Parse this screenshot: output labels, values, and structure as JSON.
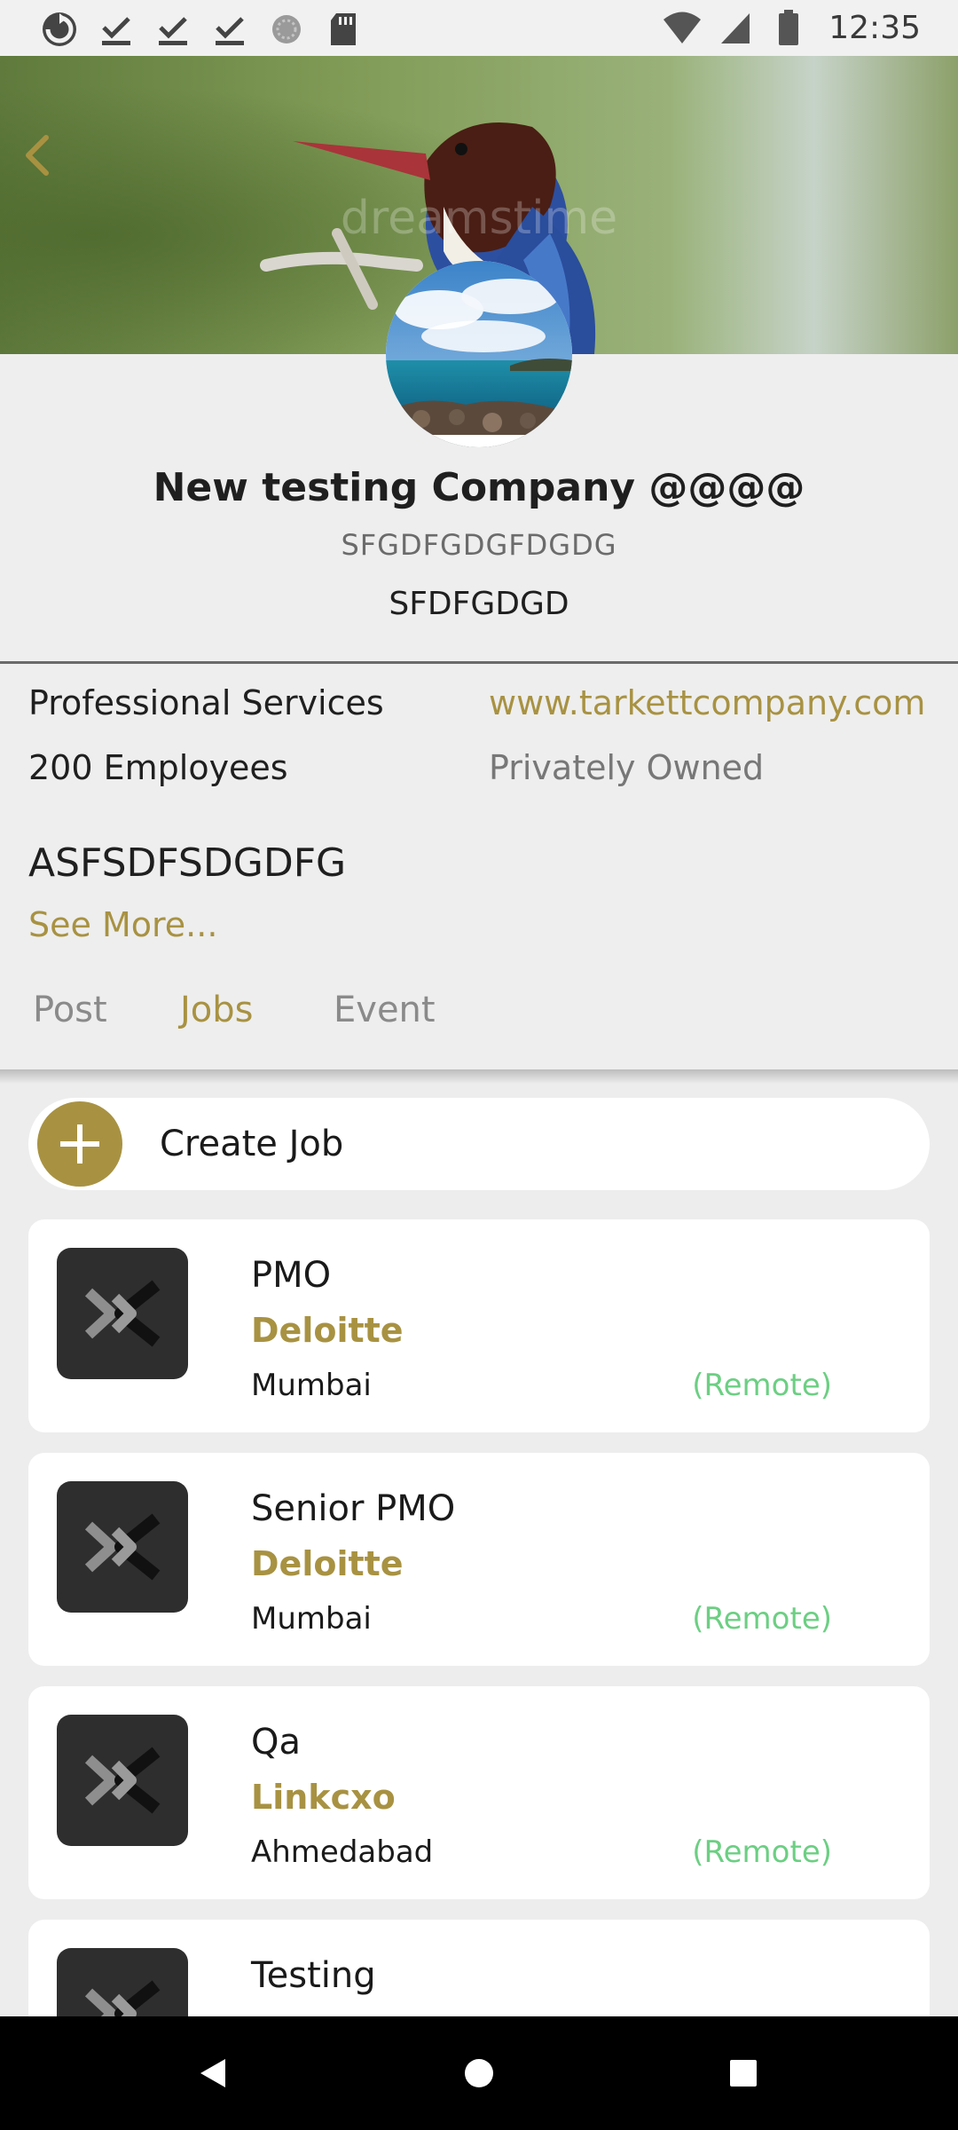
{
  "status_bar": {
    "time": "12:35",
    "icons": [
      "sync-icon",
      "download-done-icon",
      "download-done-icon",
      "download-done-icon",
      "loading-icon",
      "sd-card-icon",
      "wifi-icon",
      "signal-icon",
      "battery-icon"
    ]
  },
  "header": {
    "back_icon": "chevron-left-icon",
    "watermark": "dreamstime"
  },
  "company": {
    "name": "New testing Company @@@@",
    "code": "SFGDFGDGFDGDG",
    "tagline": "SFDFGDGD",
    "industry": "Professional Services",
    "website": "www.tarkettcompany.com",
    "size": "200 Employees",
    "ownership": "Privately Owned",
    "about": "ASFSDFSDGDFG",
    "see_more": "See More..."
  },
  "tabs": [
    {
      "label": "Post",
      "active": false
    },
    {
      "label": "Jobs",
      "active": true
    },
    {
      "label": "Event",
      "active": false
    }
  ],
  "create_job": {
    "label": "Create Job"
  },
  "jobs": [
    {
      "title": "PMO",
      "company": "Deloitte",
      "location": "Mumbai",
      "mode": "(Remote)"
    },
    {
      "title": "Senior PMO",
      "company": "Deloitte",
      "location": "Mumbai",
      "mode": "(Remote)"
    },
    {
      "title": "Qa",
      "company": "Linkcxo",
      "location": "Ahmedabad",
      "mode": "(Remote)"
    },
    {
      "title": "Testing",
      "company": "",
      "location": "",
      "mode": ""
    }
  ],
  "colors": {
    "accent": "#a89242",
    "remote": "#6ccf83",
    "background": "#eeeeee"
  }
}
